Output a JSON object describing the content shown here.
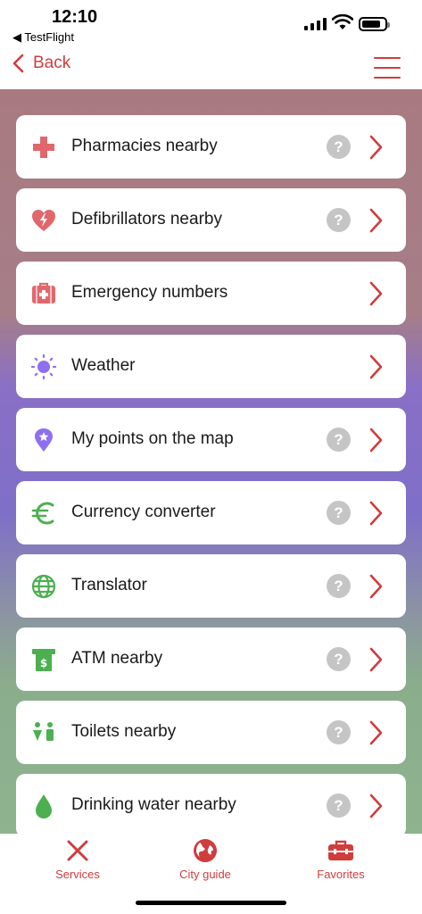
{
  "status": {
    "time": "12:10",
    "back_app": "◀ TestFlight"
  },
  "nav": {
    "back_label": "Back"
  },
  "colors": {
    "accent": "#cf3d3d",
    "red_icon": "#e0686c",
    "purple_icon": "#8e6ff0",
    "green_icon": "#4caf50"
  },
  "items": [
    {
      "label": "Pharmacies nearby",
      "icon": "cross-icon",
      "help": "?"
    },
    {
      "label": "Defibrillators nearby",
      "icon": "heart-bolt-icon",
      "help": "?"
    },
    {
      "label": "Emergency numbers",
      "icon": "first-aid-kit-icon"
    },
    {
      "label": "Weather",
      "icon": "sun-icon"
    },
    {
      "label": "My points on the map",
      "icon": "map-pin-star-icon",
      "help": "?"
    },
    {
      "label": "Currency converter",
      "icon": "euro-icon",
      "help": "?"
    },
    {
      "label": "Translator",
      "icon": "globe-icon",
      "help": "?"
    },
    {
      "label": "ATM nearby",
      "icon": "atm-icon",
      "help": "?"
    },
    {
      "label": "Toilets nearby",
      "icon": "toilet-icon",
      "help": "?"
    },
    {
      "label": "Drinking water nearby",
      "icon": "water-drop-icon",
      "help": "?"
    }
  ],
  "tabs": [
    {
      "label": "Services",
      "icon": "close-x-icon"
    },
    {
      "label": "City guide",
      "icon": "globe-icon"
    },
    {
      "label": "Favorites",
      "icon": "toolbox-icon"
    }
  ]
}
